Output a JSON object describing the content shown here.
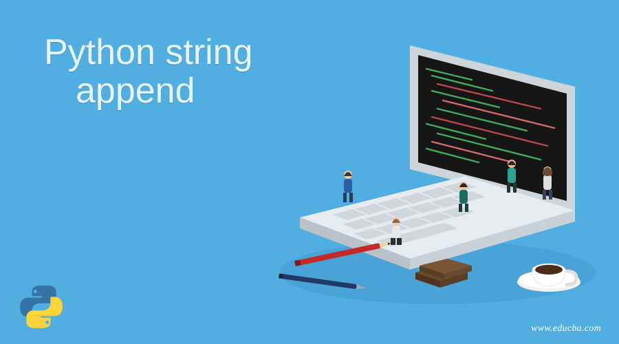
{
  "title_line1": "Python string",
  "title_line2": "append",
  "url": "www.educba.com",
  "logo_name": "python-logo",
  "illustration_name": "laptop-team-isometric-illustration",
  "colors": {
    "bg": "#51aee0",
    "title": "#e8f4fb",
    "url": "#ffffff"
  }
}
